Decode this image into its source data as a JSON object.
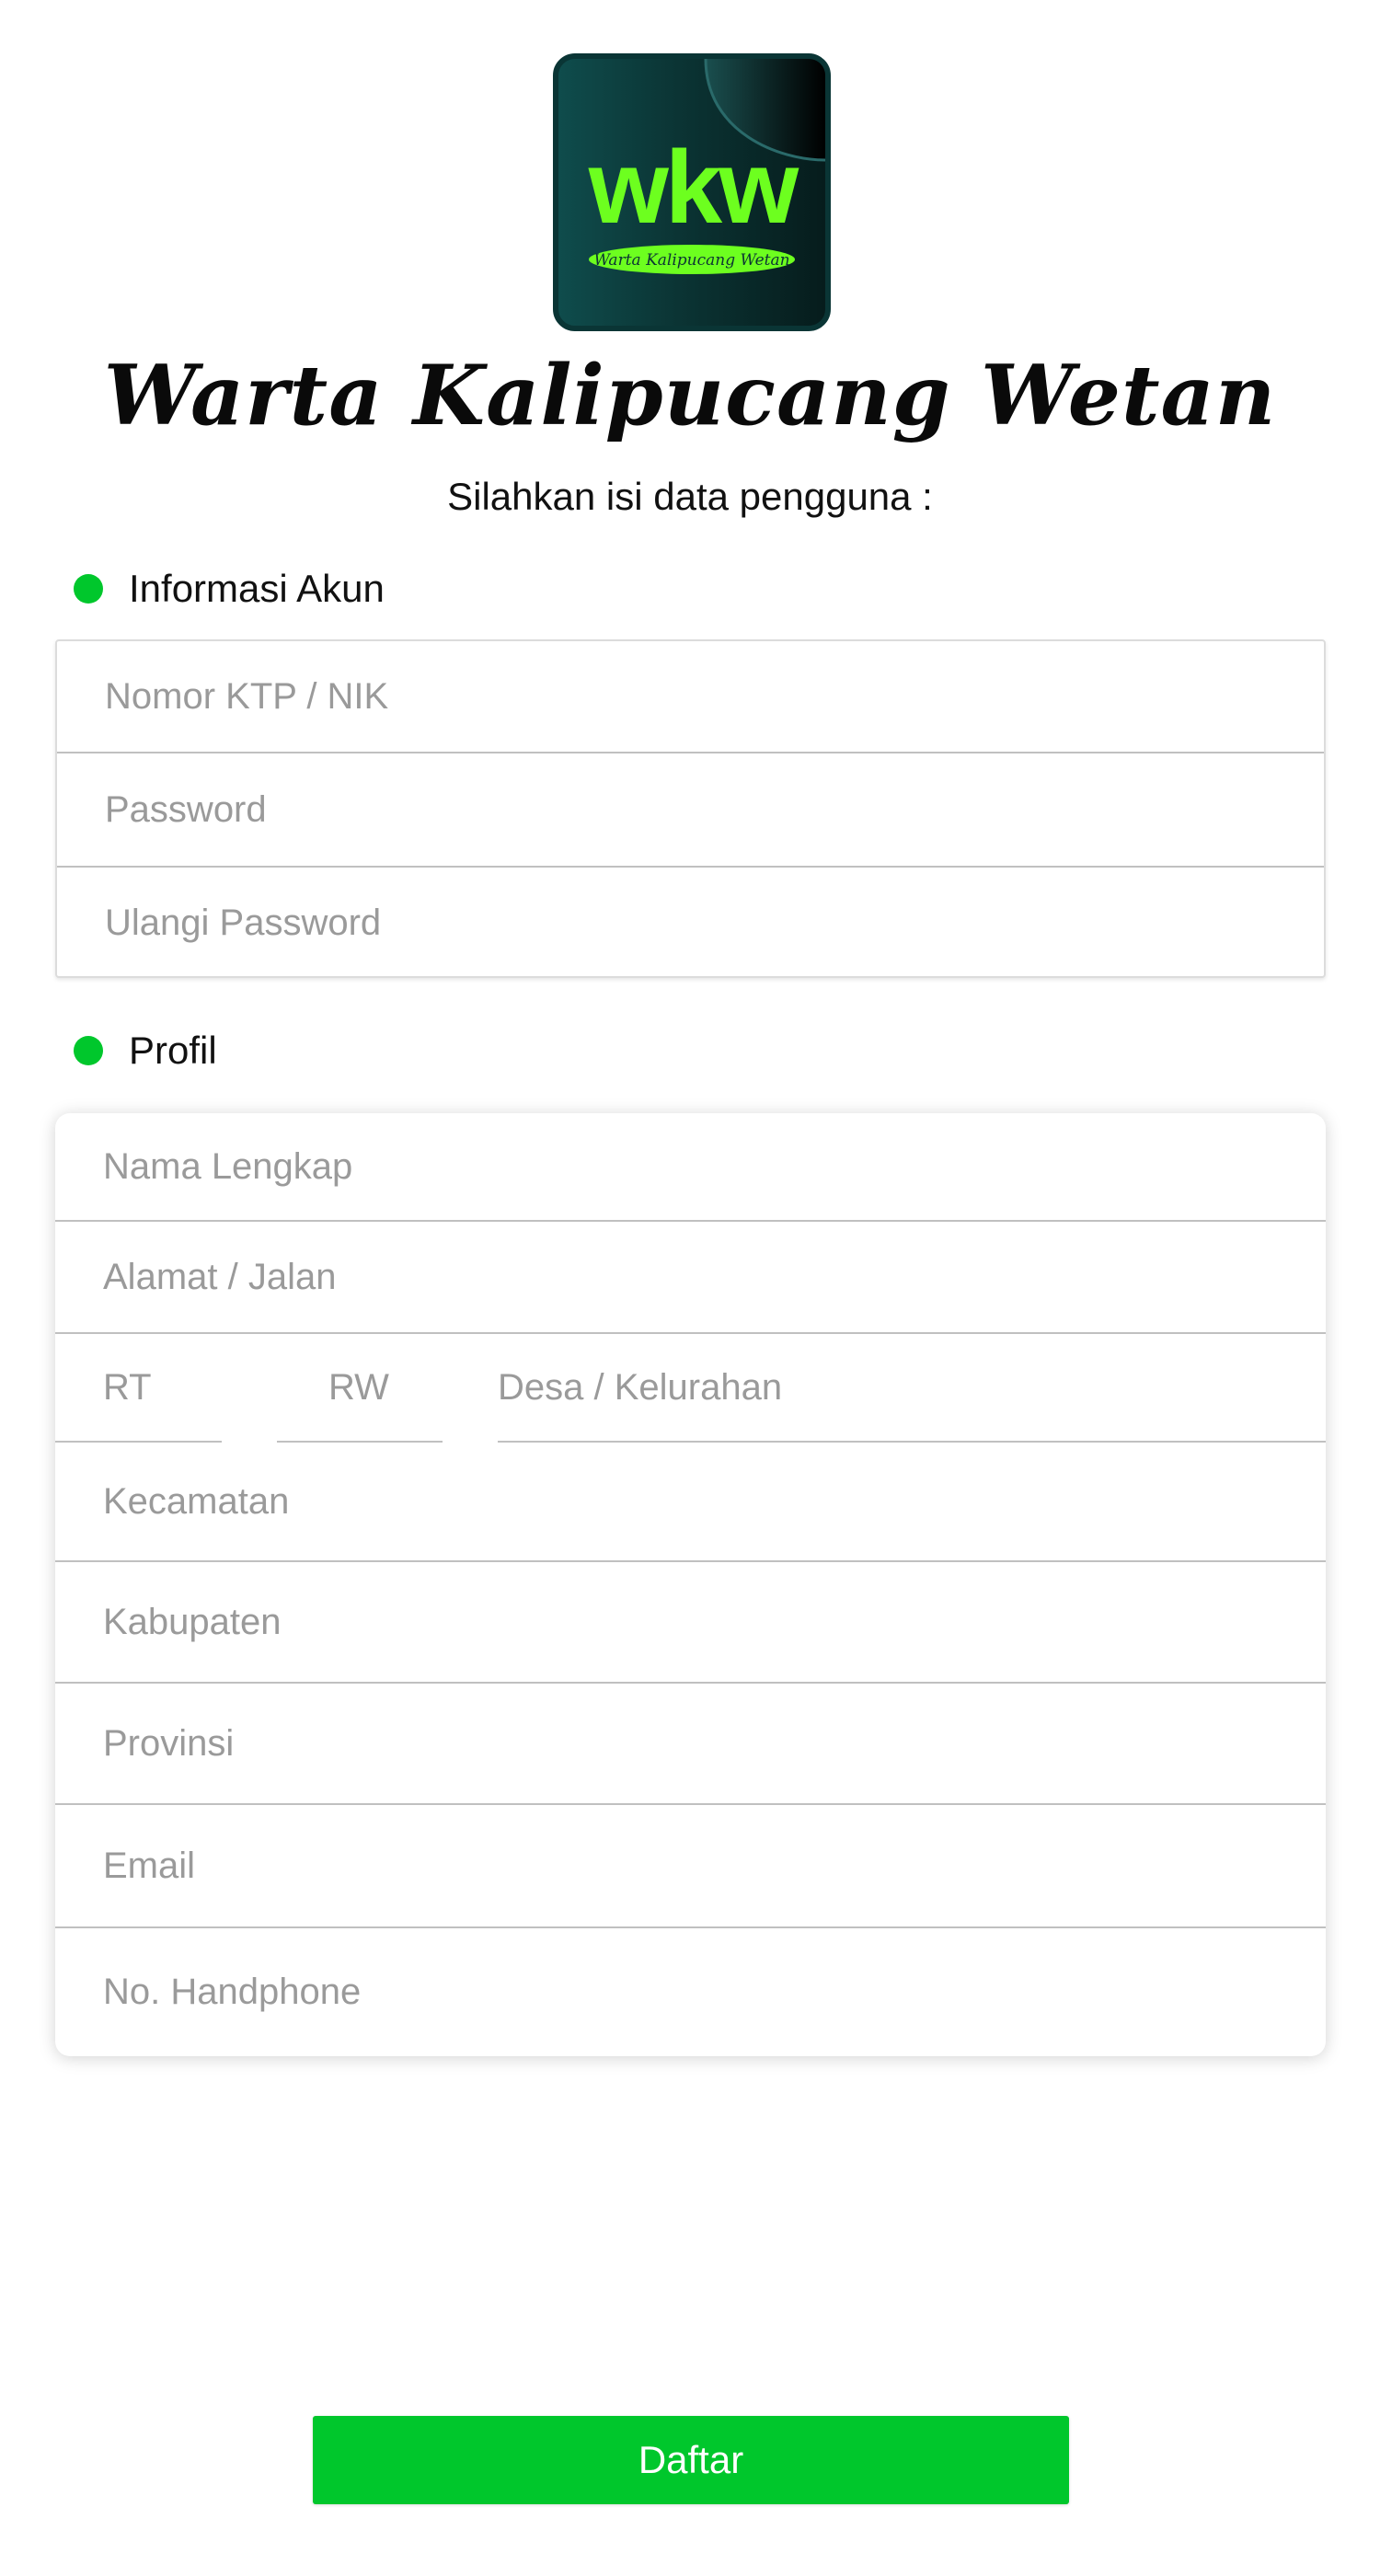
{
  "app": {
    "title": "Warta Kalipucang Wetan",
    "subtitle": "Silahkan isi data pengguna :",
    "logo": {
      "initials": "wkw",
      "tagline": "Warta Kalipucang Wetan"
    }
  },
  "colors": {
    "accent": "#00c72c",
    "logo_green": "#6dff1f",
    "logo_dark": "#0b3434"
  },
  "sections": {
    "account": {
      "label": "Informasi Akun",
      "fields": {
        "nik": {
          "placeholder": "Nomor KTP / NIK",
          "value": ""
        },
        "password": {
          "placeholder": "Password",
          "value": ""
        },
        "password_confirm": {
          "placeholder": "Ulangi Password",
          "value": ""
        }
      }
    },
    "profile": {
      "label": "Profil",
      "fields": {
        "full_name": {
          "placeholder": "Nama Lengkap",
          "value": ""
        },
        "address": {
          "placeholder": "Alamat / Jalan",
          "value": ""
        },
        "rt": {
          "placeholder": "RT",
          "value": ""
        },
        "rw": {
          "placeholder": "RW",
          "value": ""
        },
        "village": {
          "placeholder": "Desa / Kelurahan",
          "value": ""
        },
        "district": {
          "placeholder": "Kecamatan",
          "value": ""
        },
        "regency": {
          "placeholder": "Kabupaten",
          "value": ""
        },
        "province": {
          "placeholder": "Provinsi",
          "value": ""
        },
        "email": {
          "placeholder": "Email",
          "value": ""
        },
        "phone": {
          "placeholder": "No. Handphone",
          "value": ""
        }
      }
    }
  },
  "actions": {
    "submit_label": "Daftar"
  }
}
